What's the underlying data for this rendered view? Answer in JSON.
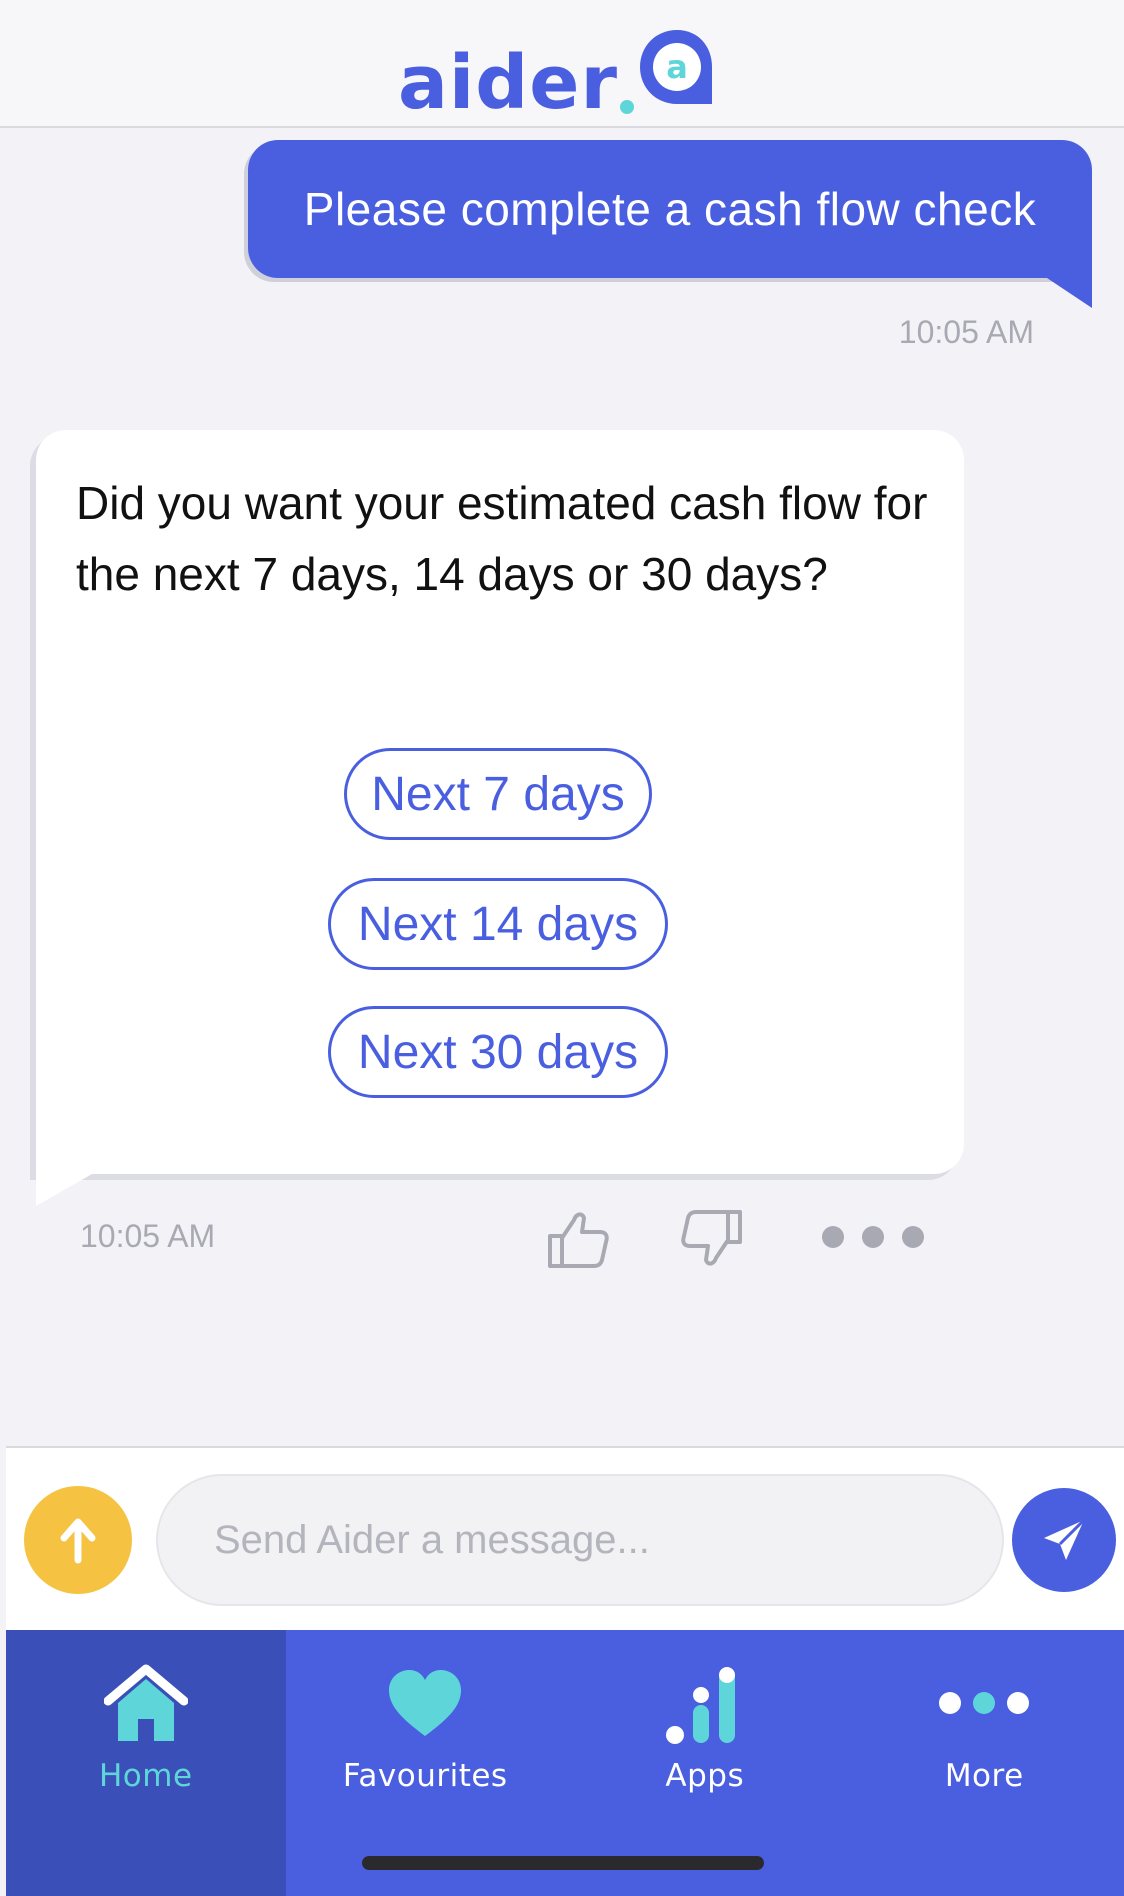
{
  "app": {
    "logo_text": "aider",
    "brand_color": "#4a5fe0",
    "accent_color": "#5ed6d9"
  },
  "chat": {
    "user_message": {
      "text": "Please complete a cash flow check",
      "time": "10:05 AM"
    },
    "bot_message": {
      "text": "Did you want your estimated cash flow for the next 7 days, 14 days or 30 days?",
      "time": "10:05 AM",
      "options": [
        "Next 7 days",
        "Next 14 days",
        "Next 30 days"
      ],
      "reactions": [
        "thumbs-up-icon",
        "thumbs-down-icon",
        "more-dots-icon"
      ]
    }
  },
  "composer": {
    "placeholder": "Send Aider a message...",
    "upload_icon": "arrow-up-icon",
    "send_icon": "send-icon",
    "upload_color": "#f5c242"
  },
  "nav": {
    "items": [
      {
        "label": "Home",
        "icon": "home-icon",
        "active": true
      },
      {
        "label": "Favourites",
        "icon": "heart-icon",
        "active": false
      },
      {
        "label": "Apps",
        "icon": "apps-bars-icon",
        "active": false
      },
      {
        "label": "More",
        "icon": "more-dots-icon",
        "active": false
      }
    ]
  }
}
